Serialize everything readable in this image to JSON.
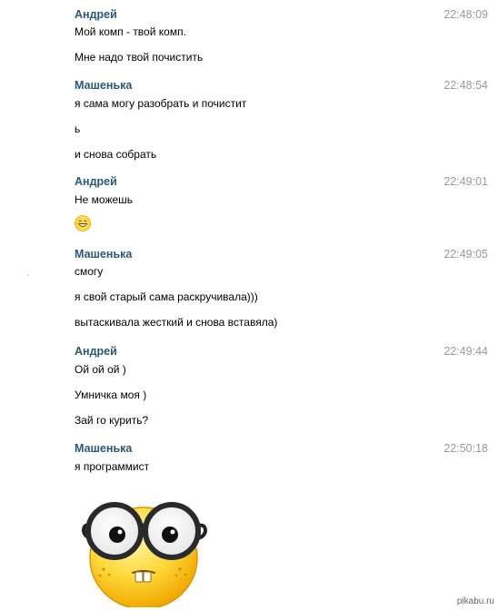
{
  "messages": [
    {
      "author": "Андрей",
      "time": "22:48:09",
      "lines": [
        "Мой комп - твой комп.",
        "Мне надо твой почистить"
      ]
    },
    {
      "author": "Машенька",
      "time": "22:48:54",
      "lines": [
        "я сама могу разобрать и почистит",
        "ь",
        "и снова собрать"
      ]
    },
    {
      "author": "Андрей",
      "time": "22:49:01",
      "lines": [
        "Не можешь"
      ],
      "emoji": "grin-emoji"
    },
    {
      "author": "Машенька",
      "time": "22:49:05",
      "lines": [
        "смогу",
        "я свой старый сама раскручивала)))",
        "вытаскивала жесткий и снова вставяла)"
      ]
    },
    {
      "author": "Андрей",
      "time": "22:49:44",
      "lines": [
        "Ой ой ой )",
        "Умничка моя )",
        "Зай го курить?"
      ]
    },
    {
      "author": "Машенька",
      "time": "22:50:18",
      "lines": [
        "я программист"
      ],
      "sticker": "nerd-smiley-sticker"
    }
  ],
  "watermark": "pikabu.ru"
}
